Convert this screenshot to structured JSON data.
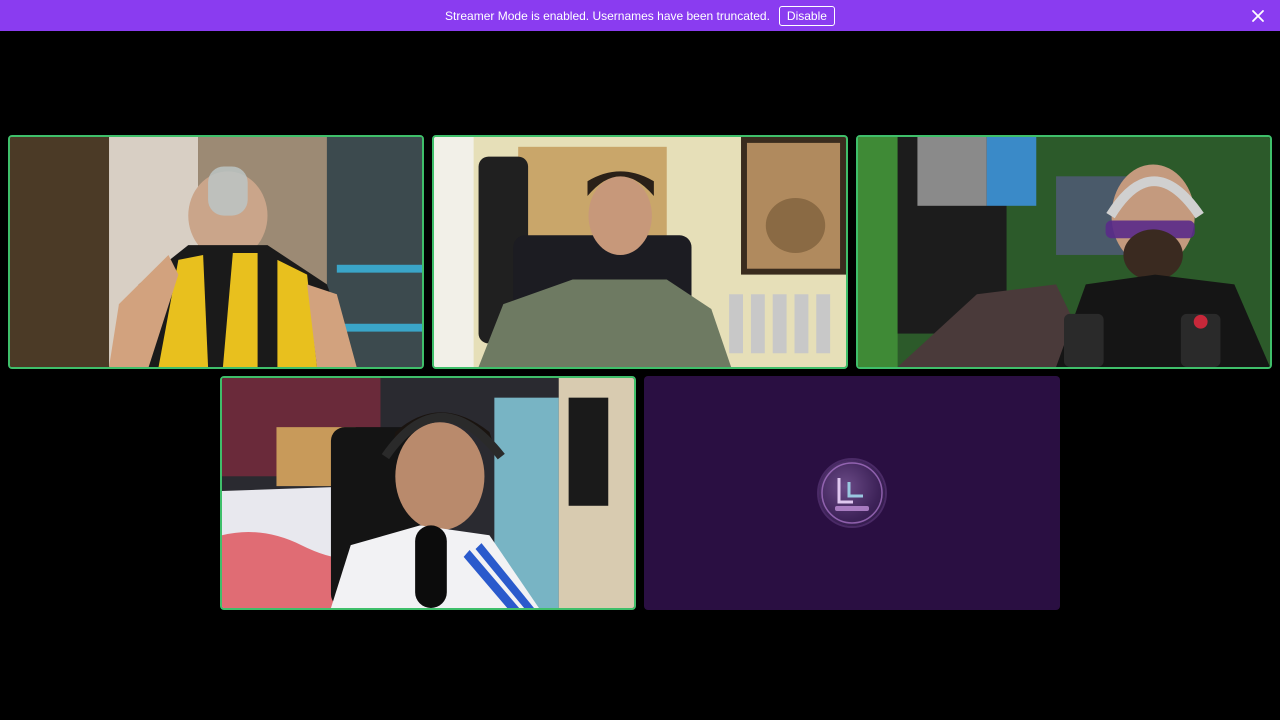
{
  "banner": {
    "message": "Streamer Mode is enabled. Usernames have been truncated.",
    "disable_label": "Disable",
    "background": "#8a3cf0"
  },
  "call": {
    "active_speaker_border": "#3fbf6a",
    "empty_tile_color": "#2a0f42",
    "participants": [
      {
        "tile": "participant-1",
        "video": true,
        "scene": "drinking from a glass, yellow-black striped jersey"
      },
      {
        "tile": "participant-2",
        "video": true,
        "scene": "green t-shirt, earphones, Rey Leon poster and trophies"
      },
      {
        "tile": "participant-3",
        "video": true,
        "scene": "headphones, tinted glasses, microphone, green wall"
      },
      {
        "tile": "participant-4",
        "video": true,
        "scene": "headphones, white jersey, microphone, bedroom"
      },
      {
        "tile": "participant-5",
        "video": false,
        "avatar": "server-logo-avatar"
      }
    ]
  },
  "avatar_text": "LL"
}
